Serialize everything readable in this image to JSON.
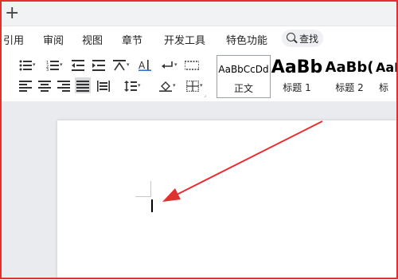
{
  "titlebar": {
    "new_tab_icon": "plus-icon"
  },
  "menu": {
    "items": [
      "引用",
      "审阅",
      "视图",
      "章节",
      "开发工具",
      "特色功能"
    ],
    "search_label": "查找"
  },
  "ribbon": {
    "tools_row1": [
      "bullets-list",
      "numbered-list",
      "decrease-indent",
      "increase-indent",
      "chinese-layout",
      "text-direction",
      "line-break",
      "show-marks"
    ],
    "tools_row2": [
      "align-left",
      "align-center",
      "align-right",
      "justify",
      "distributed",
      "line-spacing",
      "shading",
      "borders"
    ],
    "styles": [
      {
        "sample": "AaBbCcDd",
        "name": "正文"
      },
      {
        "sample": "AaBb",
        "name": "标题 1"
      },
      {
        "sample": "AaBb(",
        "name": "标题 2"
      },
      {
        "sample": "AaB",
        "name": "标"
      }
    ]
  },
  "annotation": {
    "color": "#e0302f"
  }
}
